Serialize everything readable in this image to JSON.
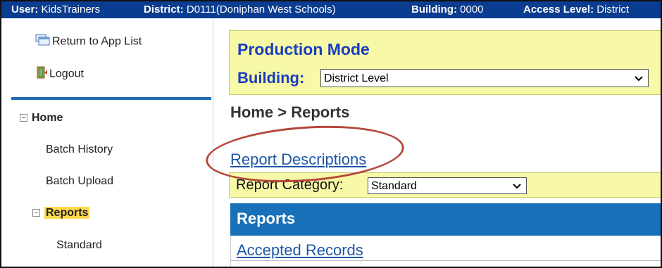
{
  "topbar": {
    "user_label": "User:",
    "user_value": "KidsTrainers",
    "district_label": "District:",
    "district_value": "D0111(Doniphan West Schools)",
    "building_label": "Building:",
    "building_value": "0000",
    "access_label": "Access Level:",
    "access_value": "District"
  },
  "sidebar": {
    "return_link": "Return to App List",
    "logout_link": "Logout",
    "home": "Home",
    "batch_history": "Batch History",
    "batch_upload": "Batch Upload",
    "reports": "Reports",
    "standard": "Standard"
  },
  "main": {
    "mode": "Production Mode",
    "building_label": "Building:",
    "building_selected": "District Level",
    "breadcrumb": "Home > Reports",
    "report_descriptions": "Report Descriptions",
    "report_category_label": "Report Category:",
    "report_category_selected": "Standard",
    "reports_header": "Reports",
    "accepted_records": "Accepted Records"
  },
  "colors": {
    "topbar_bg": "#0a3d8f",
    "highlight_yellow": "#f7f9a6",
    "link_blue": "#1d58a6",
    "header_blue": "#1770b8",
    "annotation_red": "#b5473a"
  }
}
